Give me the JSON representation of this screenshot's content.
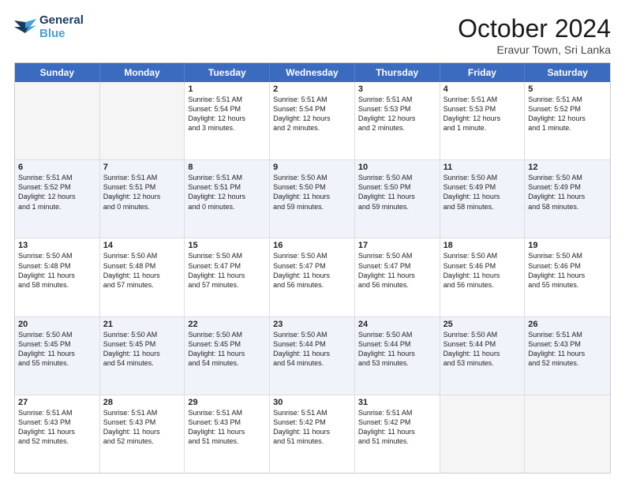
{
  "logo": {
    "line1": "General",
    "line2": "Blue"
  },
  "title": "October 2024",
  "subtitle": "Eravur Town, Sri Lanka",
  "days": [
    "Sunday",
    "Monday",
    "Tuesday",
    "Wednesday",
    "Thursday",
    "Friday",
    "Saturday"
  ],
  "rows": [
    [
      {
        "day": "",
        "lines": [],
        "empty": true
      },
      {
        "day": "",
        "lines": [],
        "empty": true
      },
      {
        "day": "1",
        "lines": [
          "Sunrise: 5:51 AM",
          "Sunset: 5:54 PM",
          "Daylight: 12 hours",
          "and 3 minutes."
        ]
      },
      {
        "day": "2",
        "lines": [
          "Sunrise: 5:51 AM",
          "Sunset: 5:54 PM",
          "Daylight: 12 hours",
          "and 2 minutes."
        ]
      },
      {
        "day": "3",
        "lines": [
          "Sunrise: 5:51 AM",
          "Sunset: 5:53 PM",
          "Daylight: 12 hours",
          "and 2 minutes."
        ]
      },
      {
        "day": "4",
        "lines": [
          "Sunrise: 5:51 AM",
          "Sunset: 5:53 PM",
          "Daylight: 12 hours",
          "and 1 minute."
        ]
      },
      {
        "day": "5",
        "lines": [
          "Sunrise: 5:51 AM",
          "Sunset: 5:52 PM",
          "Daylight: 12 hours",
          "and 1 minute."
        ]
      }
    ],
    [
      {
        "day": "6",
        "lines": [
          "Sunrise: 5:51 AM",
          "Sunset: 5:52 PM",
          "Daylight: 12 hours",
          "and 1 minute."
        ]
      },
      {
        "day": "7",
        "lines": [
          "Sunrise: 5:51 AM",
          "Sunset: 5:51 PM",
          "Daylight: 12 hours",
          "and 0 minutes."
        ]
      },
      {
        "day": "8",
        "lines": [
          "Sunrise: 5:51 AM",
          "Sunset: 5:51 PM",
          "Daylight: 12 hours",
          "and 0 minutes."
        ]
      },
      {
        "day": "9",
        "lines": [
          "Sunrise: 5:50 AM",
          "Sunset: 5:50 PM",
          "Daylight: 11 hours",
          "and 59 minutes."
        ]
      },
      {
        "day": "10",
        "lines": [
          "Sunrise: 5:50 AM",
          "Sunset: 5:50 PM",
          "Daylight: 11 hours",
          "and 59 minutes."
        ]
      },
      {
        "day": "11",
        "lines": [
          "Sunrise: 5:50 AM",
          "Sunset: 5:49 PM",
          "Daylight: 11 hours",
          "and 58 minutes."
        ]
      },
      {
        "day": "12",
        "lines": [
          "Sunrise: 5:50 AM",
          "Sunset: 5:49 PM",
          "Daylight: 11 hours",
          "and 58 minutes."
        ]
      }
    ],
    [
      {
        "day": "13",
        "lines": [
          "Sunrise: 5:50 AM",
          "Sunset: 5:48 PM",
          "Daylight: 11 hours",
          "and 58 minutes."
        ]
      },
      {
        "day": "14",
        "lines": [
          "Sunrise: 5:50 AM",
          "Sunset: 5:48 PM",
          "Daylight: 11 hours",
          "and 57 minutes."
        ]
      },
      {
        "day": "15",
        "lines": [
          "Sunrise: 5:50 AM",
          "Sunset: 5:47 PM",
          "Daylight: 11 hours",
          "and 57 minutes."
        ]
      },
      {
        "day": "16",
        "lines": [
          "Sunrise: 5:50 AM",
          "Sunset: 5:47 PM",
          "Daylight: 11 hours",
          "and 56 minutes."
        ]
      },
      {
        "day": "17",
        "lines": [
          "Sunrise: 5:50 AM",
          "Sunset: 5:47 PM",
          "Daylight: 11 hours",
          "and 56 minutes."
        ]
      },
      {
        "day": "18",
        "lines": [
          "Sunrise: 5:50 AM",
          "Sunset: 5:46 PM",
          "Daylight: 11 hours",
          "and 56 minutes."
        ]
      },
      {
        "day": "19",
        "lines": [
          "Sunrise: 5:50 AM",
          "Sunset: 5:46 PM",
          "Daylight: 11 hours",
          "and 55 minutes."
        ]
      }
    ],
    [
      {
        "day": "20",
        "lines": [
          "Sunrise: 5:50 AM",
          "Sunset: 5:45 PM",
          "Daylight: 11 hours",
          "and 55 minutes."
        ]
      },
      {
        "day": "21",
        "lines": [
          "Sunrise: 5:50 AM",
          "Sunset: 5:45 PM",
          "Daylight: 11 hours",
          "and 54 minutes."
        ]
      },
      {
        "day": "22",
        "lines": [
          "Sunrise: 5:50 AM",
          "Sunset: 5:45 PM",
          "Daylight: 11 hours",
          "and 54 minutes."
        ]
      },
      {
        "day": "23",
        "lines": [
          "Sunrise: 5:50 AM",
          "Sunset: 5:44 PM",
          "Daylight: 11 hours",
          "and 54 minutes."
        ]
      },
      {
        "day": "24",
        "lines": [
          "Sunrise: 5:50 AM",
          "Sunset: 5:44 PM",
          "Daylight: 11 hours",
          "and 53 minutes."
        ]
      },
      {
        "day": "25",
        "lines": [
          "Sunrise: 5:50 AM",
          "Sunset: 5:44 PM",
          "Daylight: 11 hours",
          "and 53 minutes."
        ]
      },
      {
        "day": "26",
        "lines": [
          "Sunrise: 5:51 AM",
          "Sunset: 5:43 PM",
          "Daylight: 11 hours",
          "and 52 minutes."
        ]
      }
    ],
    [
      {
        "day": "27",
        "lines": [
          "Sunrise: 5:51 AM",
          "Sunset: 5:43 PM",
          "Daylight: 11 hours",
          "and 52 minutes."
        ]
      },
      {
        "day": "28",
        "lines": [
          "Sunrise: 5:51 AM",
          "Sunset: 5:43 PM",
          "Daylight: 11 hours",
          "and 52 minutes."
        ]
      },
      {
        "day": "29",
        "lines": [
          "Sunrise: 5:51 AM",
          "Sunset: 5:43 PM",
          "Daylight: 11 hours",
          "and 51 minutes."
        ]
      },
      {
        "day": "30",
        "lines": [
          "Sunrise: 5:51 AM",
          "Sunset: 5:42 PM",
          "Daylight: 11 hours",
          "and 51 minutes."
        ]
      },
      {
        "day": "31",
        "lines": [
          "Sunrise: 5:51 AM",
          "Sunset: 5:42 PM",
          "Daylight: 11 hours",
          "and 51 minutes."
        ]
      },
      {
        "day": "",
        "lines": [],
        "empty": true
      },
      {
        "day": "",
        "lines": [],
        "empty": true
      }
    ]
  ]
}
